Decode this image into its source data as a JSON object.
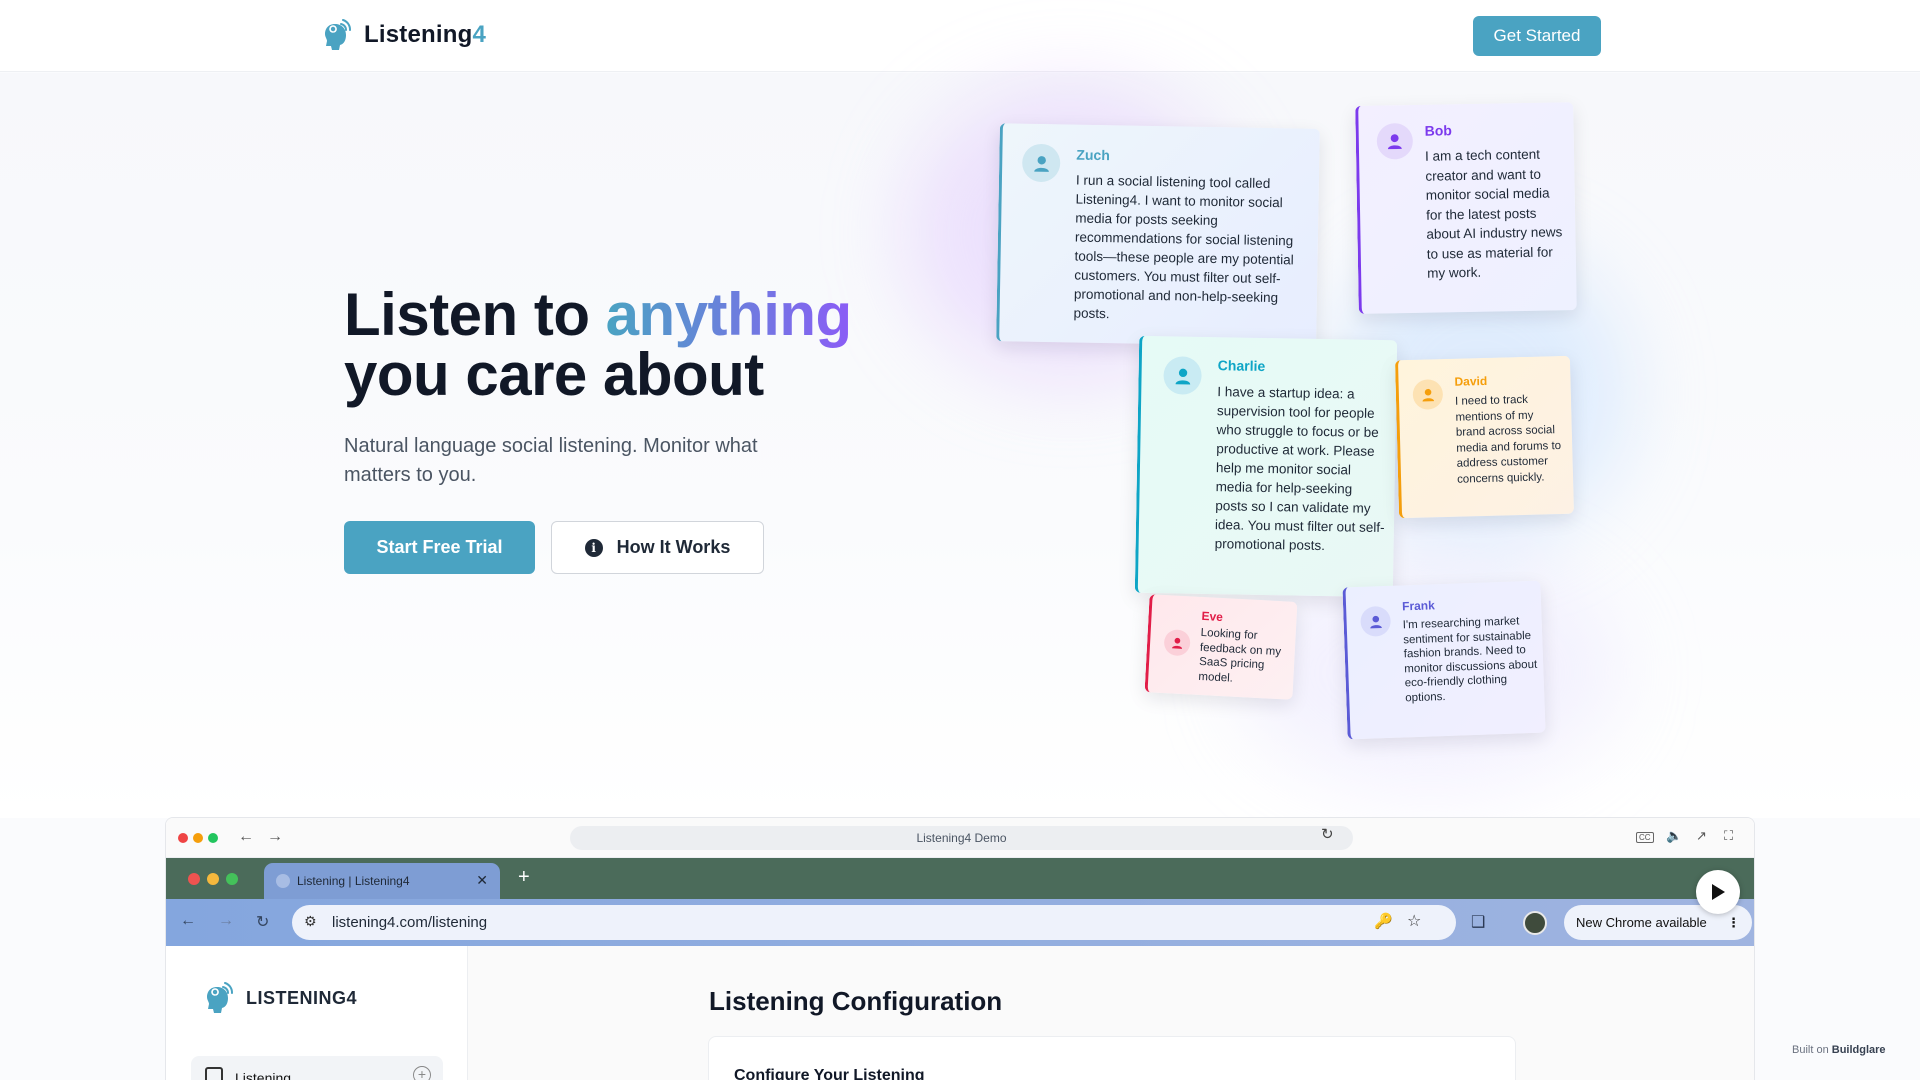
{
  "header": {
    "brand_name": "Listening",
    "brand_accent": "4",
    "cta_label": "Get Started"
  },
  "hero": {
    "title_part1": "Listen to ",
    "title_highlight": "anything",
    "title_part2": "you care about",
    "subtitle": "Natural language social listening. Monitor what matters to you.",
    "primary_button": "Start Free Trial",
    "secondary_button": "How It Works",
    "secondary_icon": "info-icon"
  },
  "cards": [
    {
      "name": "Zuch",
      "color": "#4aa3c2",
      "text": "I run a social listening tool called Listening4. I want to monitor social media for posts seeking recommendations for social listening tools—these people are my potential customers. You must filter out self-promotional and non-help-seeking posts."
    },
    {
      "name": "Bob",
      "color": "#7c3aed",
      "text": "I am a tech content creator and want to monitor social media for the latest posts about AI industry news to use as material for my work."
    },
    {
      "name": "Charlie",
      "color": "#0ea5c6",
      "text": "I have a startup idea: a supervision tool for people who struggle to focus or be productive at work. Please help me monitor social media for help-seeking posts so I can validate my idea. You must filter out self-promotional posts."
    },
    {
      "name": "David",
      "color": "#f59e0b",
      "text": "I need to track mentions of my brand across social media and forums to address customer concerns quickly."
    },
    {
      "name": "Eve",
      "color": "#e11d48",
      "text": "Looking for feedback on my SaaS pricing model."
    },
    {
      "name": "Frank",
      "color": "#5b5bd6",
      "text": "I'm researching market sentiment for sustainable fashion brands. Need to monitor discussions about eco-friendly clothing options."
    }
  ],
  "demo": {
    "window_title": "Listening4 Demo",
    "tab_title": "Listening | Listening4",
    "url": "listening4.com/listening",
    "new_chrome_label": "New Chrome available",
    "app_logo_name": "LISTENING4",
    "sidebar_item": "Listening",
    "page_title": "Listening Configuration",
    "card_title": "Configure Your Listening"
  },
  "footer": {
    "built_on_prefix": "Built on ",
    "built_on_brand": "Buildglare"
  }
}
